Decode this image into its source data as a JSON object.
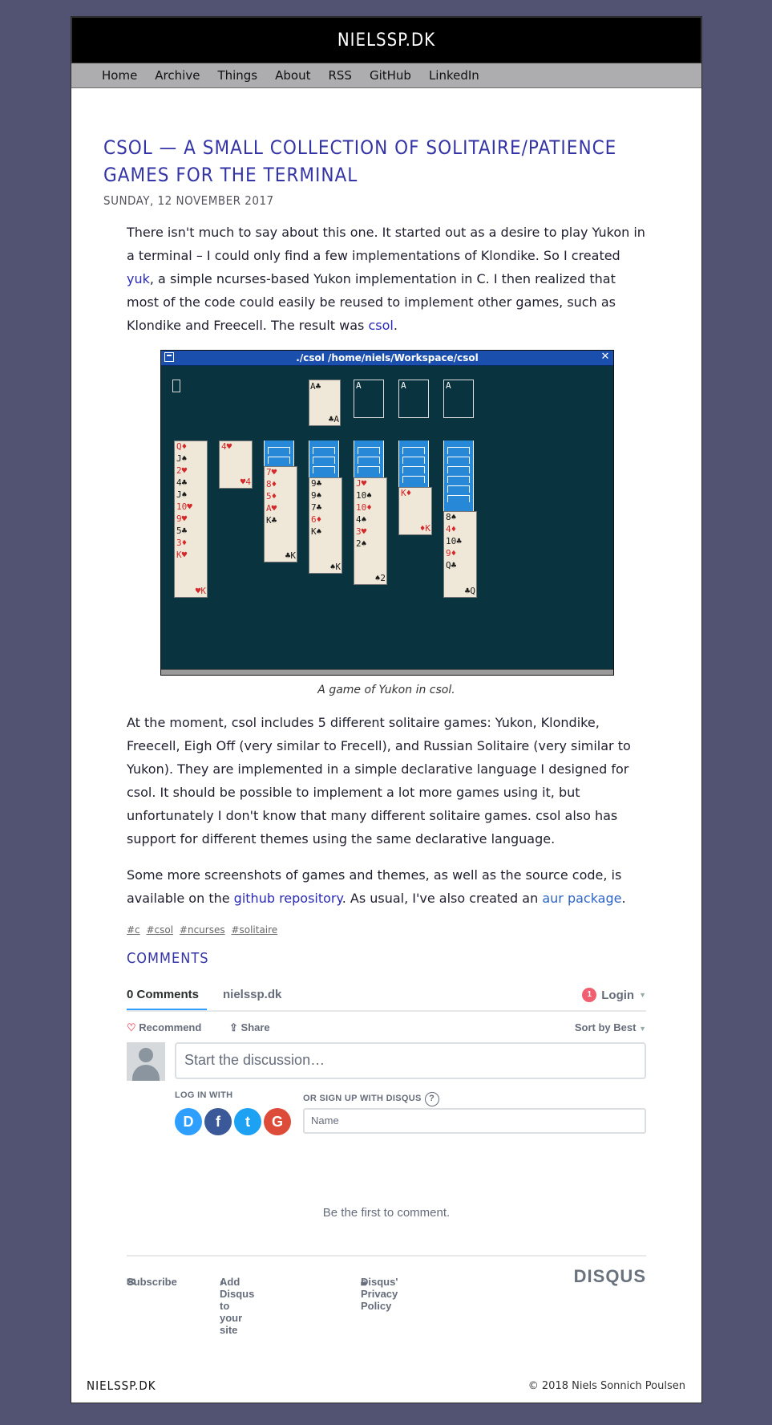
{
  "site": {
    "title": "NIELSSP.DK"
  },
  "nav": [
    "Home",
    "Archive",
    "Things",
    "About",
    "RSS",
    "GitHub",
    "LinkedIn"
  ],
  "post": {
    "title": "CSOL — A SMALL COLLECTION OF SOLITAIRE/PATIENCE GAMES FOR THE TERMINAL",
    "date": "SUNDAY, 12 NOVEMBER 2017",
    "p1_a": "There isn't much to say about this one. It started out as a desire to play Yukon in a terminal – I could only find a few implementations of Klondike. So I created ",
    "p1_link1": "yuk",
    "p1_b": ", a simple ncurses-based Yukon implementation in C. I then realized that most of the code could easily be reused to implement other games, such as Klondike and Freecell. The result was ",
    "p1_link2": "csol",
    "p1_c": ".",
    "terminal_title": "./csol  /home/niels/Workspace/csol",
    "caption": "A game of Yukon in csol.",
    "p2": "At the moment, csol includes 5 different solitaire games: Yukon, Klondike, Freecell, Eigh Off (very similar to Frecell), and Russian Solitaire (very similar to Yukon). They are implemented in a simple declarative language I designed for csol. It should be possible to implement a lot more games using it, but unfortunately I don't know that many different solitaire games. csol also has support for different themes using the same declarative language.",
    "p3_a": "Some more screenshots of games and themes, as well as the source code, is available on the ",
    "p3_link1": "github repository",
    "p3_b": ". As usual, I've also created an ",
    "p3_link2": "aur package",
    "p3_c": ".",
    "tags": [
      "#c",
      "#csol",
      "#ncurses",
      "#solitaire"
    ],
    "comments_heading": "COMMENTS"
  },
  "cards": {
    "foundation": [
      "A♣",
      "A",
      "A",
      "A"
    ],
    "foundation_corner": "♣A",
    "col1": [
      "Q♦",
      "J♠",
      "2♥",
      "4♣",
      "J♠",
      "10♥",
      "9♥",
      "5♣",
      "3♦",
      "K♥"
    ],
    "col1_corner": "♥K",
    "col2": [
      "4♥"
    ],
    "col2_corner": "♥4",
    "col3": [
      "7♥",
      "8♦",
      "5♦",
      "A♥",
      "K♣"
    ],
    "col3_corner": "♣K",
    "col4": [
      "9♣",
      "9♠",
      "7♣",
      "6♦",
      "K♠"
    ],
    "col4_corner": "♠K",
    "col5": [
      "J♥",
      "10♠",
      "10♦",
      "4♠",
      "3♥",
      "2♠"
    ],
    "col5_corner": "♠2",
    "col6": [
      "K♦"
    ],
    "col6_corner": "♦K",
    "col7": [
      "8♠",
      "4♦",
      "10♣",
      "9♦",
      "Q♣"
    ],
    "col7_corner": "♣Q"
  },
  "disqus": {
    "tab_comments": "0 Comments",
    "tab_site": "nielssp.dk",
    "login_badge": "1",
    "login": "Login",
    "recommend": "Recommend",
    "share": "Share",
    "sort": "Sort by Best",
    "placeholder": "Start the discussion…",
    "log_in_with": "LOG IN WITH",
    "or_sign_up": "OR SIGN UP WITH DISQUS",
    "name_placeholder": "Name",
    "first_comment": "Be the first to comment.",
    "subscribe": "Subscribe",
    "add_disqus": "Add Disqus to your site",
    "privacy": "Disqus' Privacy Policy",
    "logo": "DISQUS"
  },
  "footer": {
    "title": "NIELSSP.DK",
    "copyright": "© 2018 Niels Sonnich Poulsen"
  }
}
